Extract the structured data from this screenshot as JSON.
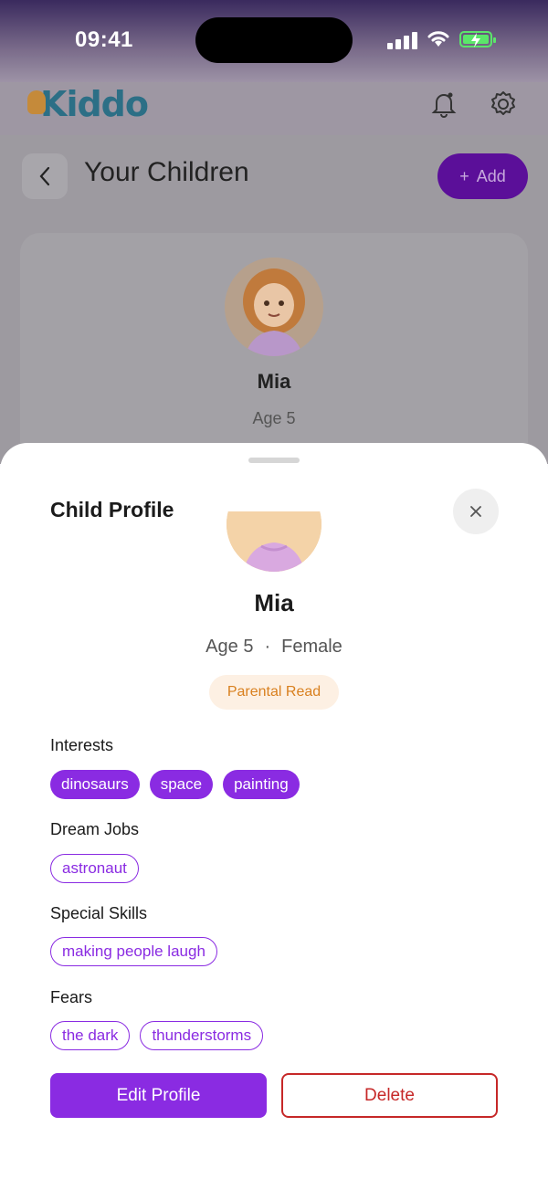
{
  "status_bar": {
    "time": "09:41"
  },
  "app": {
    "logo_text": "Kiddo"
  },
  "page": {
    "title": "Your Children",
    "add_label": "Add",
    "child_card": {
      "name": "Mia",
      "age": "Age 5"
    }
  },
  "sheet": {
    "title": "Child Profile",
    "name": "Mia",
    "age": "Age 5",
    "separator": "·",
    "gender": "Female",
    "reading_mode": "Parental Read",
    "sections": {
      "interests": {
        "label": "Interests",
        "items": [
          "dinosaurs",
          "space",
          "painting"
        ]
      },
      "dream_jobs": {
        "label": "Dream Jobs",
        "items": [
          "astronaut"
        ]
      },
      "special_skills": {
        "label": "Special Skills",
        "items": [
          "making people laugh"
        ]
      },
      "fears": {
        "label": "Fears",
        "items": [
          "the dark",
          "thunderstorms"
        ]
      }
    },
    "edit_label": "Edit Profile",
    "delete_label": "Delete"
  },
  "colors": {
    "accent": "#8a2be2",
    "danger": "#c62828",
    "badge_text": "#d9801f",
    "badge_bg": "#fdf0e3"
  }
}
